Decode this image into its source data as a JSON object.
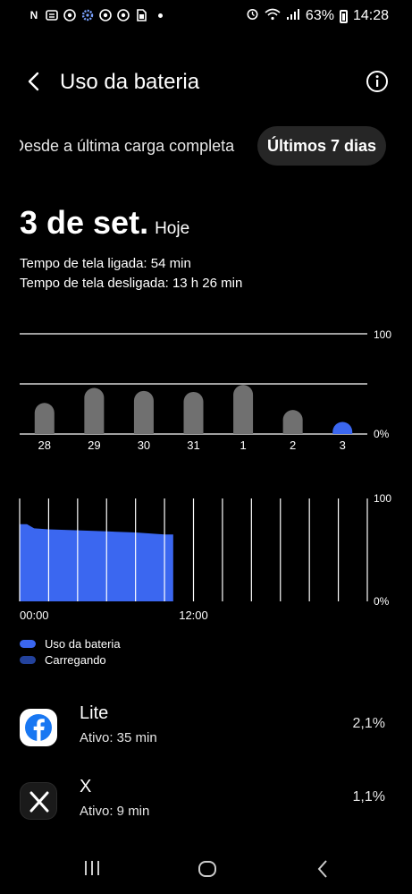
{
  "status_bar": {
    "left_icons": [
      "notification-n-icon",
      "news-icon",
      "chrome-icon",
      "settings-flower-icon",
      "chrome-icon",
      "chrome-icon",
      "sim-icon"
    ],
    "battery_percent": "63%",
    "time": "14:28"
  },
  "header": {
    "title": "Uso da bateria"
  },
  "tabs": {
    "since_last_charge": "Desde a última carga completa",
    "last_7_days": "Últimos 7 dias"
  },
  "summary": {
    "date": "3 de set.",
    "date_suffix": "Hoje",
    "screen_on": "Tempo de tela ligada: 54 min",
    "screen_off": "Tempo de tela desligada: 13 h 26 min"
  },
  "colors": {
    "accent": "#3b67f0",
    "charging": "#23429c",
    "bar_grey": "#707070"
  },
  "chart_data": [
    {
      "type": "bar",
      "categories": [
        "28",
        "29",
        "30",
        "31",
        "1",
        "2",
        "3"
      ],
      "values": [
        31,
        46,
        43,
        42,
        49,
        24,
        12
      ],
      "highlight_index": 6,
      "y_tick_labels": [
        "100",
        "0%"
      ],
      "ylim": [
        0,
        100
      ]
    },
    {
      "type": "area",
      "x_tick_labels": [
        "00:00",
        "12:00"
      ],
      "y_tick_labels": [
        "100",
        "0%"
      ],
      "x_hours": [
        0,
        0.2,
        0.5,
        1.0,
        2.0,
        4.0,
        6.0,
        8.0,
        9.0,
        10.0,
        10.6
      ],
      "values": [
        75,
        75,
        75,
        71,
        70,
        69,
        68,
        67,
        66,
        65,
        65
      ],
      "xlim": [
        0,
        24
      ],
      "ylim": [
        0,
        100
      ],
      "series": [
        {
          "name": "Uso da bateria",
          "color": "#3b67f0"
        },
        {
          "name": "Carregando",
          "color": "#23429c"
        }
      ]
    }
  ],
  "legend": {
    "usage": "Uso da bateria",
    "charging": "Carregando"
  },
  "apps": [
    {
      "name": "Lite",
      "active": "Ativo: 35 min",
      "percent": "2,1%",
      "icon": "facebook-icon"
    },
    {
      "name": "X",
      "active": "Ativo: 9 min",
      "percent": "1,1%",
      "icon": "x-icon"
    }
  ]
}
